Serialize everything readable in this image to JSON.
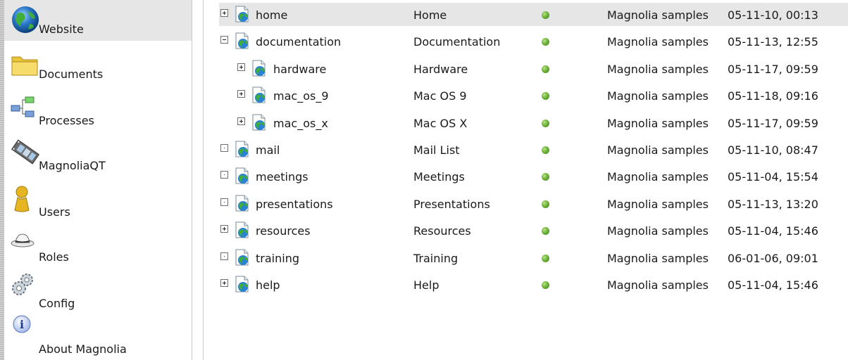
{
  "sidebar": {
    "items": [
      {
        "label": "Website",
        "icon": "globe-icon",
        "active": true
      },
      {
        "label": "Documents",
        "icon": "folder-icon"
      },
      {
        "label": "Processes",
        "icon": "process-icon"
      },
      {
        "label": "MagnoliaQT",
        "icon": "film-icon"
      },
      {
        "label": "Users",
        "icon": "user-icon"
      },
      {
        "label": "Roles",
        "icon": "hat-icon"
      },
      {
        "label": "Config",
        "icon": "gears-icon"
      },
      {
        "label": "About Magnolia",
        "icon": "info-icon"
      }
    ]
  },
  "tree": {
    "rows": [
      {
        "name": "home",
        "title": "Home",
        "template": "Magnolia samples",
        "date": "05-11-10, 00:13"
      },
      {
        "name": "documentation",
        "title": "Documentation",
        "template": "Magnolia samples",
        "date": "05-11-13, 12:55"
      },
      {
        "name": "hardware",
        "title": "Hardware",
        "template": "Magnolia samples",
        "date": "05-11-17, 09:59"
      },
      {
        "name": "mac_os_9",
        "title": "Mac OS 9",
        "template": "Magnolia samples",
        "date": "05-11-18, 09:16"
      },
      {
        "name": "mac_os_x",
        "title": "Mac OS X",
        "template": "Magnolia samples",
        "date": "05-11-17, 09:59"
      },
      {
        "name": "mail",
        "title": "Mail List",
        "template": "Magnolia samples",
        "date": "05-11-10, 08:47"
      },
      {
        "name": "meetings",
        "title": "Meetings",
        "template": "Magnolia samples",
        "date": "05-11-04, 15:54"
      },
      {
        "name": "presentations",
        "title": "Presentations",
        "template": "Magnolia samples",
        "date": "05-11-13, 13:20"
      },
      {
        "name": "resources",
        "title": "Resources",
        "template": "Magnolia samples",
        "date": "05-11-04, 15:46"
      },
      {
        "name": "training",
        "title": "Training",
        "template": "Magnolia samples",
        "date": "06-01-06, 09:01"
      },
      {
        "name": "help",
        "title": "Help",
        "template": "Magnolia samples",
        "date": "05-11-04, 15:46"
      }
    ]
  },
  "colors": {
    "status_active": "#5aa02c",
    "selection": "#e6e6e6"
  }
}
